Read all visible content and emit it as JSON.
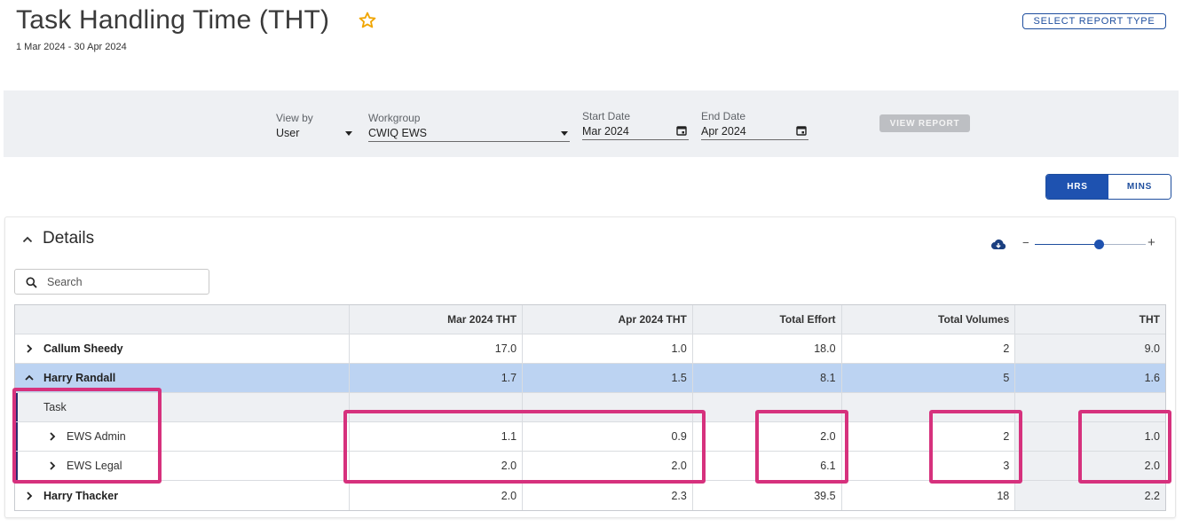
{
  "header": {
    "title": "Task Handling Time (THT)",
    "date_range": "1 Mar 2024 - 30 Apr 2024",
    "select_report_label": "SELECT REPORT TYPE",
    "star_icon": "star-outline-icon"
  },
  "filters": {
    "view_by": {
      "label": "View by",
      "value": "User"
    },
    "workgroup": {
      "label": "Workgroup",
      "value": "CWIQ EWS"
    },
    "start_date": {
      "label": "Start Date",
      "value": "Mar 2024"
    },
    "end_date": {
      "label": "End Date",
      "value": "Apr 2024"
    },
    "view_report_label": "VIEW REPORT"
  },
  "unit_toggle": {
    "hrs": "HRS",
    "mins": "MINS",
    "active": "HRS"
  },
  "details": {
    "title": "Details",
    "search_placeholder": "Search",
    "zoom_minus": "−",
    "zoom_plus": "+",
    "zoom_level": 0.6
  },
  "table": {
    "columns": [
      "",
      "Mar 2024 THT",
      "Apr 2024 THT",
      "Total Effort",
      "Total Volumes",
      "THT"
    ],
    "rows": [
      {
        "name": "Callum Sheedy",
        "mar": "17.0",
        "apr": "1.0",
        "effort": "18.0",
        "volumes": "2",
        "tht": "9.0"
      },
      {
        "name": "Harry Randall",
        "mar": "1.7",
        "apr": "1.5",
        "effort": "8.1",
        "volumes": "5",
        "tht": "1.6"
      },
      {
        "group_label": "Task"
      },
      {
        "name": "EWS Admin",
        "mar": "1.1",
        "apr": "0.9",
        "effort": "2.0",
        "volumes": "2",
        "tht": "1.0"
      },
      {
        "name": "EWS Legal",
        "mar": "2.0",
        "apr": "2.0",
        "effort": "6.1",
        "volumes": "3",
        "tht": "2.0"
      },
      {
        "name": "Harry Thacker",
        "mar": "2.0",
        "apr": "2.3",
        "effort": "39.5",
        "volumes": "18",
        "tht": "2.2"
      }
    ]
  },
  "colors": {
    "primary": "#1e52b0",
    "highlight": "#d6317d",
    "selected_row": "#bcd3f2",
    "panel": "#eef0f3"
  }
}
